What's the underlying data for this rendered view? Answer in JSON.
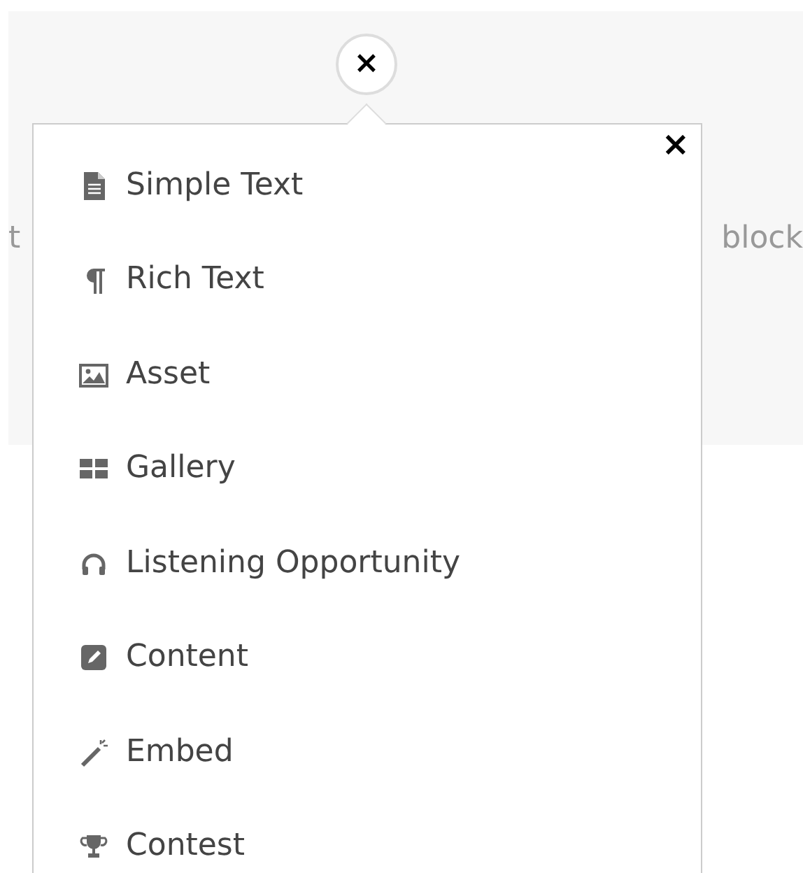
{
  "background": {
    "left_text": "t",
    "right_text": "block"
  },
  "toggle_button": {
    "label": "×"
  },
  "menu": {
    "close_label": "×",
    "items": [
      {
        "label": "Simple Text",
        "kind": "document"
      },
      {
        "label": "Rich Text",
        "kind": "paragraph"
      },
      {
        "label": "Asset",
        "kind": "image"
      },
      {
        "label": "Gallery",
        "kind": "grid"
      },
      {
        "label": "Listening Opportunity",
        "kind": "headphones"
      },
      {
        "label": "Content",
        "kind": "edit"
      },
      {
        "label": "Embed",
        "kind": "wand"
      },
      {
        "label": "Contest",
        "kind": "trophy"
      }
    ]
  }
}
